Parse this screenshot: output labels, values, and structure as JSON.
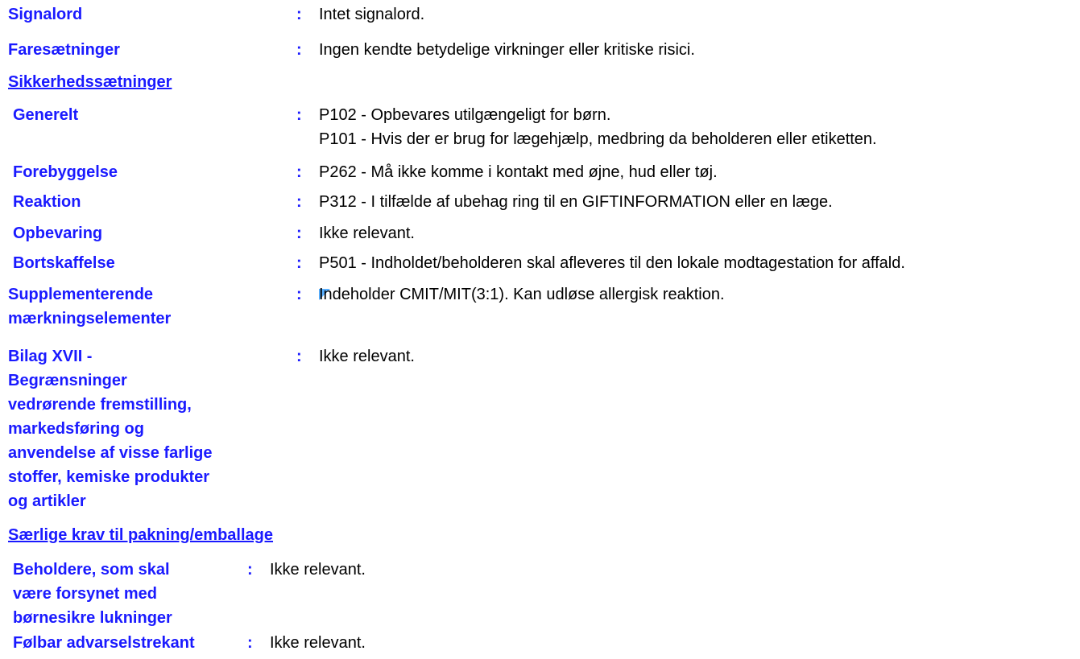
{
  "signalord": {
    "label": "Signalord",
    "value": "Intet signalord."
  },
  "faresaetninger": {
    "label": "Faresætninger",
    "value": "Ingen kendte betydelige virkninger eller kritiske risici."
  },
  "sikkerhedssaetninger": {
    "heading": "Sikkerhedssætninger",
    "generelt": {
      "label": "Generelt",
      "line1": "P102 - Opbevares utilgængeligt for børn.",
      "line2": "P101 - Hvis der er brug for lægehjælp, medbring da beholderen eller etiketten."
    },
    "forebyggelse": {
      "label": "Forebyggelse",
      "value": "P262 - Må ikke komme i kontakt med øjne, hud eller tøj."
    },
    "reaktion": {
      "label": "Reaktion",
      "value": "P312 - I tilfælde af ubehag ring til en GIFTINFORMATION eller en læge."
    },
    "opbevaring": {
      "label": "Opbevaring",
      "value": "Ikke relevant."
    },
    "bortskaffelse": {
      "label": "Bortskaffelse",
      "value": "P501 - Indholdet/beholderen skal afleveres til den lokale modtagestation for affald."
    }
  },
  "supplementerende": {
    "label1": "Supplementerende",
    "label2": "mærkningselementer",
    "value": "Indeholder CMIT/MIT(3:1).  Kan udløse allergisk reaktion."
  },
  "bilag": {
    "lines": [
      "Bilag XVII -",
      "Begrænsninger",
      "vedrørende fremstilling,",
      "markedsføring og",
      "anvendelse af visse farlige",
      "stoffer, kemiske produkter",
      "og artikler"
    ],
    "value": "Ikke relevant."
  },
  "pakning": {
    "heading": "Særlige krav til pakning/emballage",
    "beholdere": {
      "lines": [
        "Beholdere, som skal",
        "være forsynet med",
        "børnesikre lukninger"
      ],
      "value": "Ikke relevant."
    },
    "foelbar": {
      "label": "Følbar advarselstrekant",
      "value": "Ikke relevant."
    }
  },
  "colon": ":"
}
